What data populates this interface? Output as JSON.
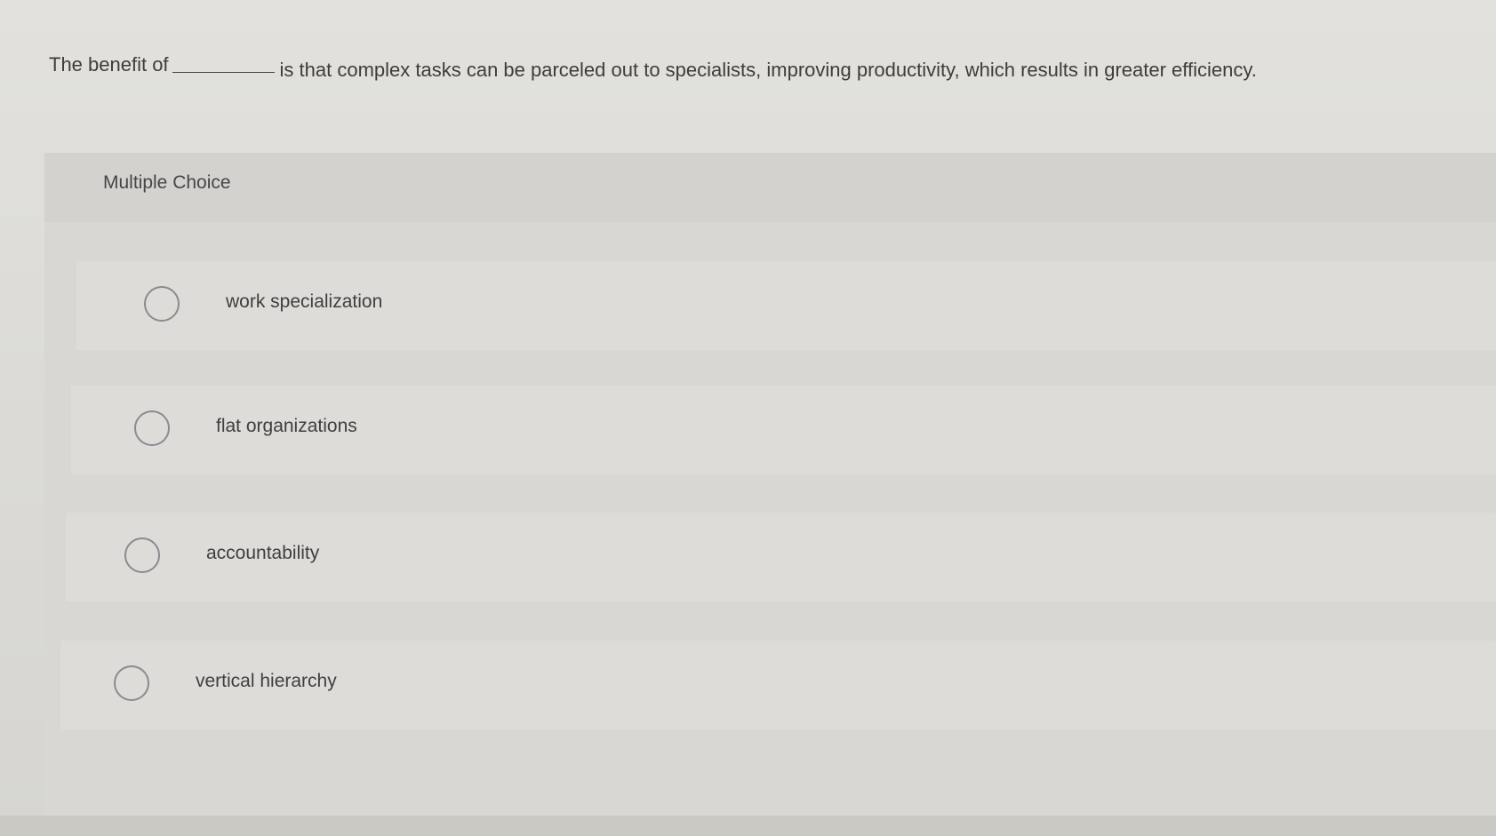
{
  "question": {
    "before_blank": "The benefit of",
    "after_blank": "is that complex tasks can be parceled out to specialists, improving productivity, which results in greater efficiency."
  },
  "multiple_choice": {
    "heading": "Multiple Choice",
    "options": [
      {
        "label": "work specialization",
        "icon": "radio-unselected-icon"
      },
      {
        "label": "flat organizations",
        "icon": "radio-unselected-icon"
      },
      {
        "label": "accountability",
        "icon": "radio-unselected-icon"
      },
      {
        "label": "vertical hierarchy",
        "icon": "radio-unselected-icon"
      }
    ]
  },
  "colors": {
    "background": "#dcdbd7",
    "text": "#3e3d3b",
    "radio_border": "#8c8a91"
  }
}
